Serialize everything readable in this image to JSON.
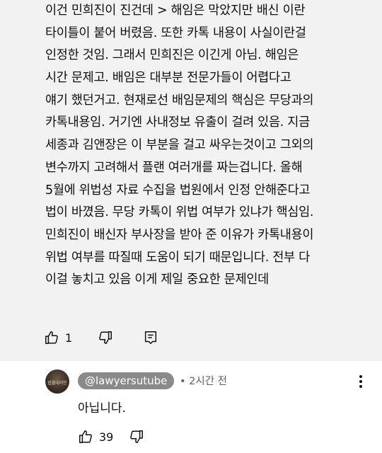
{
  "comment": {
    "lines": [
      "이건 민희진이 진건데 > 해임은 막았지만 배신 이란",
      "타이틀이 붙어 버렸음. 또한 카톡 내용이 사실이란걸",
      "인정한 것임. 그래서 민희진은 이긴게 아님. 해임은",
      "시간 문제고. 배임은 대부분 전문가들이 어렵다고",
      "얘기 했던거고. 현재로선 배임문제의 핵심은 무당과의",
      "카톡내용임. 거기엔 사내정보 유출이 걸려 있음. 지금",
      "세종과 김앤장은 이 부분을 걸고 싸우는것이고 그외의",
      "변수까지 고려해서 플랜 여러개를 짜는겁니다. 올해",
      "5월에 위법성 자료 수집을 법원에서 인정 안해준다고",
      "법이 바꼈음. 무당 카톡이 위법 여부가 있냐가 핵심임.",
      "민희진이 배신자 부사장을 받아 준 이유가 카톡내용이",
      "위법 여부를 따질때 도움이 되기 때문입니다. 전부 다",
      "이걸 놓치고 있음 이게 제일 중요한 문제인데"
    ],
    "like_count": "1",
    "icons": {
      "like": "thumbs-up-icon",
      "dislike": "thumbs-down-icon",
      "reply": "reply-comment-icon"
    }
  },
  "reply": {
    "avatar_text": "법률대리인",
    "handle": "@lawyersutube",
    "time": "• 2시간 전",
    "text": "아닙니다.",
    "like_count": "39",
    "icons": {
      "like": "thumbs-up-icon",
      "dislike": "thumbs-down-icon",
      "more": "more-vertical-icon"
    }
  }
}
